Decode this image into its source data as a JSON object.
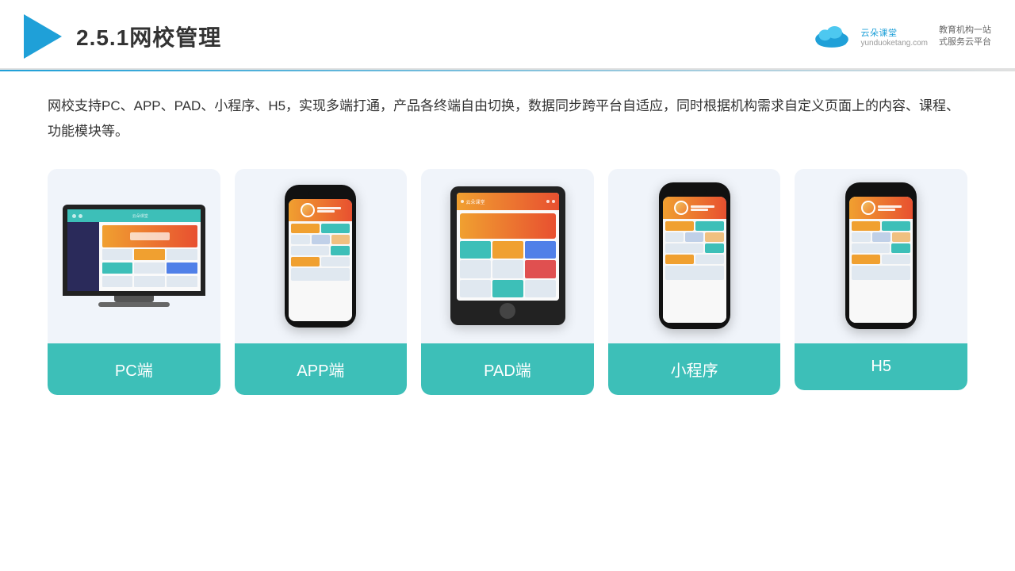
{
  "header": {
    "section_number": "2.5.1",
    "title": "网校管理",
    "brand_name": "云朵课堂",
    "brand_url": "yunduoketang.com",
    "brand_tagline_line1": "教育机构一站",
    "brand_tagline_line2": "式服务云平台"
  },
  "main": {
    "description": "网校支持PC、APP、PAD、小程序、H5，实现多端打通，产品各终端自由切换，数据同步跨平台自适应，同时根据机构需求自定义页面上的内容、课程、功能模块等。"
  },
  "cards": [
    {
      "id": "pc",
      "label": "PC端"
    },
    {
      "id": "app",
      "label": "APP端"
    },
    {
      "id": "pad",
      "label": "PAD端"
    },
    {
      "id": "miniprogram",
      "label": "小程序"
    },
    {
      "id": "h5",
      "label": "H5"
    }
  ]
}
